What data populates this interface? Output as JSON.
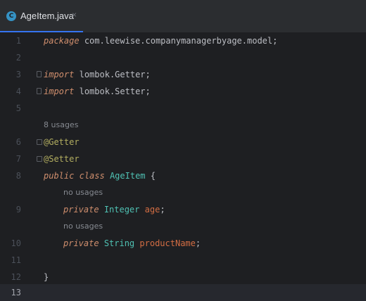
{
  "tab": {
    "icon_letter": "C",
    "title": "AgeItem.java",
    "close": "×"
  },
  "editor": {
    "line_numbers": [
      "1",
      "2",
      "3",
      "4",
      "5",
      "6",
      "7",
      "8",
      "9",
      "10",
      "11",
      "12",
      "13"
    ],
    "package_kw": "package",
    "package_name": "com.leewise.companymanagerbyage.model",
    "import_kw": "import",
    "import1": "lombok.Getter",
    "import2": "lombok.Setter",
    "usages_class": "8 usages",
    "annotation1": "@Getter",
    "annotation2": "@Setter",
    "public_kw": "public",
    "class_kw": "class",
    "class_name": "AgeItem",
    "open_brace": "{",
    "no_usages": "no usages",
    "private_kw": "private",
    "field1_type": "Integer",
    "field1_name": "age",
    "field2_type": "String",
    "field2_name": "productName",
    "close_brace": "}",
    "semicolon": ";"
  },
  "colors": {
    "background": "#1e1f22",
    "keyword": "#cf8e6d",
    "annotation": "#b3ae60",
    "type": "#4fc1b3",
    "field": "#d36d43"
  }
}
